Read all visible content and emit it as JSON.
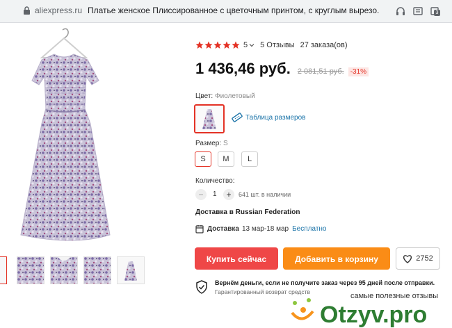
{
  "browser": {
    "domain": "aliexpress.ru",
    "tab_title": "Платье женское Плиссированное с цветочным принтом, с круглым вырезо...",
    "icons": [
      "lock-icon",
      "headphones-icon",
      "bookmark-icon",
      "download-icon",
      "notifications-icon"
    ],
    "notification_count": "3"
  },
  "product": {
    "rating_value": "5",
    "reviews": "5 Отзывы",
    "orders": "27 заказа(ов)",
    "price": "1 436,46 руб.",
    "old_price": "2 081,51 руб.",
    "discount": "-31%",
    "color_label": "Цвет:",
    "color_value": "Фиолетовый",
    "size_table": "Таблица размеров",
    "size_label": "Размер:",
    "size_value": "S",
    "sizes": [
      "S",
      "M",
      "L"
    ],
    "quantity_label": "Количество:",
    "quantity_value": "1",
    "minus": "−",
    "plus": "+",
    "stock": "641 шт. в наличии",
    "ship_to": "Доставка в Russian Federation",
    "delivery_label": "Доставка",
    "delivery_dates": "13 мар-18 мар",
    "delivery_price": "Бесплатно",
    "buy_now": "Купить сейчас",
    "add_to_cart": "Добавить в корзину",
    "wishlist_count": "2752",
    "guarantee_title": "Вернём деньги, если не получите заказ через 95 дней после отправки.",
    "guarantee_sub": "Гарантированный возврат средств"
  },
  "watermark": {
    "tagline": "самые полезные отзывы",
    "brand": "Otzyv.pro"
  },
  "colors": {
    "accent_red": "#ef4747",
    "cart_orange": "#fa8c16",
    "star": "#e43225",
    "link_blue": "#1a73a8"
  }
}
